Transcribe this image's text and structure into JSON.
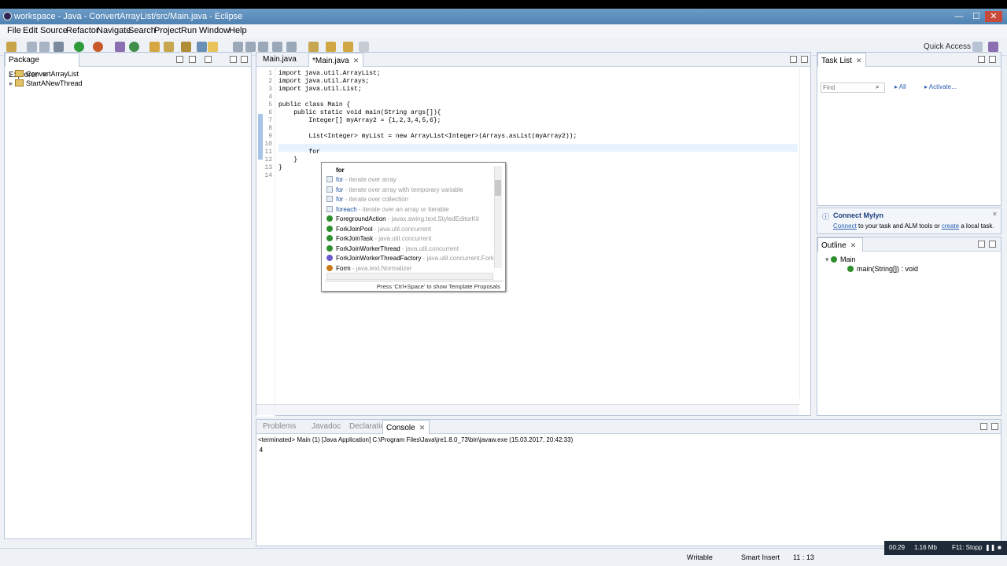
{
  "window": {
    "title": "workspace - Java - ConvertArrayList/src/Main.java - Eclipse",
    "min": "—",
    "max": "☐",
    "close": "✕"
  },
  "menu": [
    "File",
    "Edit",
    "Source",
    "Refactor",
    "Navigate",
    "Search",
    "Project",
    "Run",
    "Window",
    "Help"
  ],
  "quick_access": "Quick Access",
  "package_explorer": {
    "title": "Package Explorer",
    "items": [
      "ConvertArrayList",
      "StartANewThread"
    ]
  },
  "editor": {
    "tabs": [
      "Main.java",
      "*Main.java"
    ],
    "lines": [
      {
        "n": "1",
        "code": "import java.util.ArrayList;"
      },
      {
        "n": "2",
        "code": "import java.util.Arrays;"
      },
      {
        "n": "3",
        "code": "import java.util.List;"
      },
      {
        "n": "4",
        "code": ""
      },
      {
        "n": "5",
        "code": "public class Main {"
      },
      {
        "n": "6",
        "code": "    public static void main(String args[]){"
      },
      {
        "n": "7",
        "code": "        Integer[] myArray2 = {1,2,3,4,5,6};"
      },
      {
        "n": "8",
        "code": ""
      },
      {
        "n": "9",
        "code": "        List<Integer> myList = new ArrayList<Integer>(Arrays.asList(myArray2));"
      },
      {
        "n": "10",
        "code": ""
      },
      {
        "n": "11",
        "code": "        for"
      },
      {
        "n": "12",
        "code": "    }"
      },
      {
        "n": "13",
        "code": "}"
      },
      {
        "n": "14",
        "code": ""
      }
    ]
  },
  "proposals": {
    "header": "for",
    "footer": "Press 'Ctrl+Space' to show Template Proposals",
    "items": [
      {
        "name": "for",
        "desc": " - iterate over array",
        "kind": "template"
      },
      {
        "name": "for",
        "desc": " - iterate over array with temporary variable",
        "kind": "template"
      },
      {
        "name": "for",
        "desc": " - iterate over collection",
        "kind": "template"
      },
      {
        "name": "foreach",
        "desc": " - iterate over an array or Iterable",
        "kind": "template"
      },
      {
        "name": "ForegroundAction",
        "desc": " - javax.swing.text.StyledEditorKit",
        "kind": "class"
      },
      {
        "name": "ForkJoinPool",
        "desc": " - java.util.concurrent",
        "kind": "class"
      },
      {
        "name": "ForkJoinTask",
        "desc": " - java.util.concurrent",
        "kind": "class"
      },
      {
        "name": "ForkJoinWorkerThread",
        "desc": " - java.util.concurrent",
        "kind": "class"
      },
      {
        "name": "ForkJoinWorkerThreadFactory",
        "desc": " - java.util.concurrent.ForkJ",
        "kind": "interface"
      },
      {
        "name": "Form",
        "desc": " - java.text.Normalizer",
        "kind": "enum"
      }
    ]
  },
  "task_list": {
    "title": "Task List",
    "find_placeholder": "Find",
    "all": "All",
    "activate": "Activate..."
  },
  "mylyn": {
    "title": "Connect Mylyn",
    "connect": "Connect",
    "text1": " to your task and ALM tools or ",
    "create": "create",
    "text2": " a local task."
  },
  "outline": {
    "title": "Outline",
    "class": "Main",
    "method": "main(String[]) : void"
  },
  "bottom": {
    "tabs": [
      "Problems",
      "Javadoc",
      "Declaration",
      "Console"
    ],
    "console_header": "<terminated> Main (1) [Java Application] C:\\Program Files\\Java\\jre1.8.0_73\\bin\\javaw.exe (15.03.2017, 20:42:33)",
    "console_output": "4"
  },
  "status": {
    "writable": "Writable",
    "insert": "Smart Insert",
    "position": "11 : 13"
  },
  "taskbar": {
    "time": "00:29",
    "mem": "1.16 Mb",
    "key": "F11: Stopp"
  }
}
